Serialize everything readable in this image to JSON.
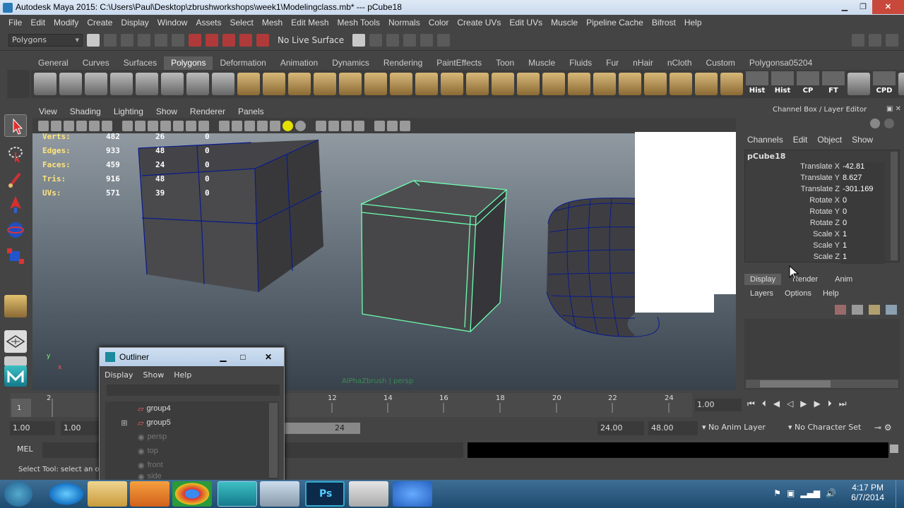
{
  "window": {
    "title": "Autodesk Maya 2015: C:\\Users\\Paul\\Desktop\\zbrushworkshops\\week1\\Modelingclass.mb*   ---   pCube18"
  },
  "menubar": [
    "File",
    "Edit",
    "Modify",
    "Create",
    "Display",
    "Window",
    "Assets",
    "Select",
    "Mesh",
    "Edit Mesh",
    "Mesh Tools",
    "Normals",
    "Color",
    "Create UVs",
    "Edit UVs",
    "Muscle",
    "Pipeline Cache",
    "Bifrost",
    "Help"
  ],
  "status": {
    "mode": "Polygons",
    "live_surface": "No Live Surface"
  },
  "shelf": {
    "tabs": [
      "General",
      "Curves",
      "Surfaces",
      "Polygons",
      "Deformation",
      "Animation",
      "Dynamics",
      "Rendering",
      "PaintEffects",
      "Toon",
      "Muscle",
      "Fluids",
      "Fur",
      "nHair",
      "nCloth",
      "Custom",
      "Polygonsa05204"
    ],
    "active": "Polygons",
    "labels": [
      "Hist",
      "Hist",
      "CP",
      "FT",
      "CPD"
    ]
  },
  "viewport": {
    "menu": [
      "View",
      "Shading",
      "Lighting",
      "Show",
      "Renderer",
      "Panels"
    ],
    "hud": [
      {
        "label": "Verts:",
        "a": "482",
        "b": "26",
        "c": "0"
      },
      {
        "label": "Edges:",
        "a": "933",
        "b": "48",
        "c": "0"
      },
      {
        "label": "Faces:",
        "a": "459",
        "b": "24",
        "c": "0"
      },
      {
        "label": "Tris:",
        "a": "916",
        "b": "48",
        "c": "0"
      },
      {
        "label": "UVs:",
        "a": "571",
        "b": "39",
        "c": "0"
      }
    ],
    "axis_x": "x",
    "axis_y": "y"
  },
  "channelbox": {
    "header": "Channel Box / Layer Editor",
    "menu": [
      "Channels",
      "Edit",
      "Object",
      "Show"
    ],
    "object": "pCube18",
    "attrs": [
      {
        "name": "Translate X",
        "value": "-42.81"
      },
      {
        "name": "Translate Y",
        "value": "8.627"
      },
      {
        "name": "Translate Z",
        "value": "-301.169"
      },
      {
        "name": "Rotate X",
        "value": "0"
      },
      {
        "name": "Rotate Y",
        "value": "0"
      },
      {
        "name": "Rotate Z",
        "value": "0"
      },
      {
        "name": "Scale X",
        "value": "1"
      },
      {
        "name": "Scale Y",
        "value": "1"
      },
      {
        "name": "Scale Z",
        "value": "1"
      }
    ],
    "layer_tabs": [
      "Display",
      "Render",
      "Anim"
    ],
    "layer_menu": [
      "Layers",
      "Options",
      "Help"
    ]
  },
  "timeline": {
    "ticks": [
      "1",
      "2",
      "12",
      "14",
      "16",
      "18",
      "20",
      "22",
      "24"
    ],
    "current": "1.00"
  },
  "range": {
    "start": "1.00",
    "start2": "1.00",
    "slider_end": "24",
    "end": "24.00",
    "end2": "48.00",
    "anim_layer": "No Anim Layer",
    "char_set": "No Character Set"
  },
  "cmd": {
    "label": "MEL"
  },
  "help": {
    "text": "Select Tool: select an obj"
  },
  "outliner": {
    "title": "Outliner",
    "menu": [
      "Display",
      "Show",
      "Help"
    ],
    "items": [
      {
        "name": "group4",
        "dim": false
      },
      {
        "name": "group5",
        "dim": false
      },
      {
        "name": "persp",
        "dim": true
      },
      {
        "name": "top",
        "dim": true
      },
      {
        "name": "front",
        "dim": true
      },
      {
        "name": "side",
        "dim": true
      }
    ]
  },
  "taskbar": {
    "time": "4:17 PM",
    "date": "6/7/2014"
  },
  "colors": {
    "selection": "#6dffb0",
    "wire": "#0a1a8a",
    "hud_label": "#ffe57a"
  }
}
